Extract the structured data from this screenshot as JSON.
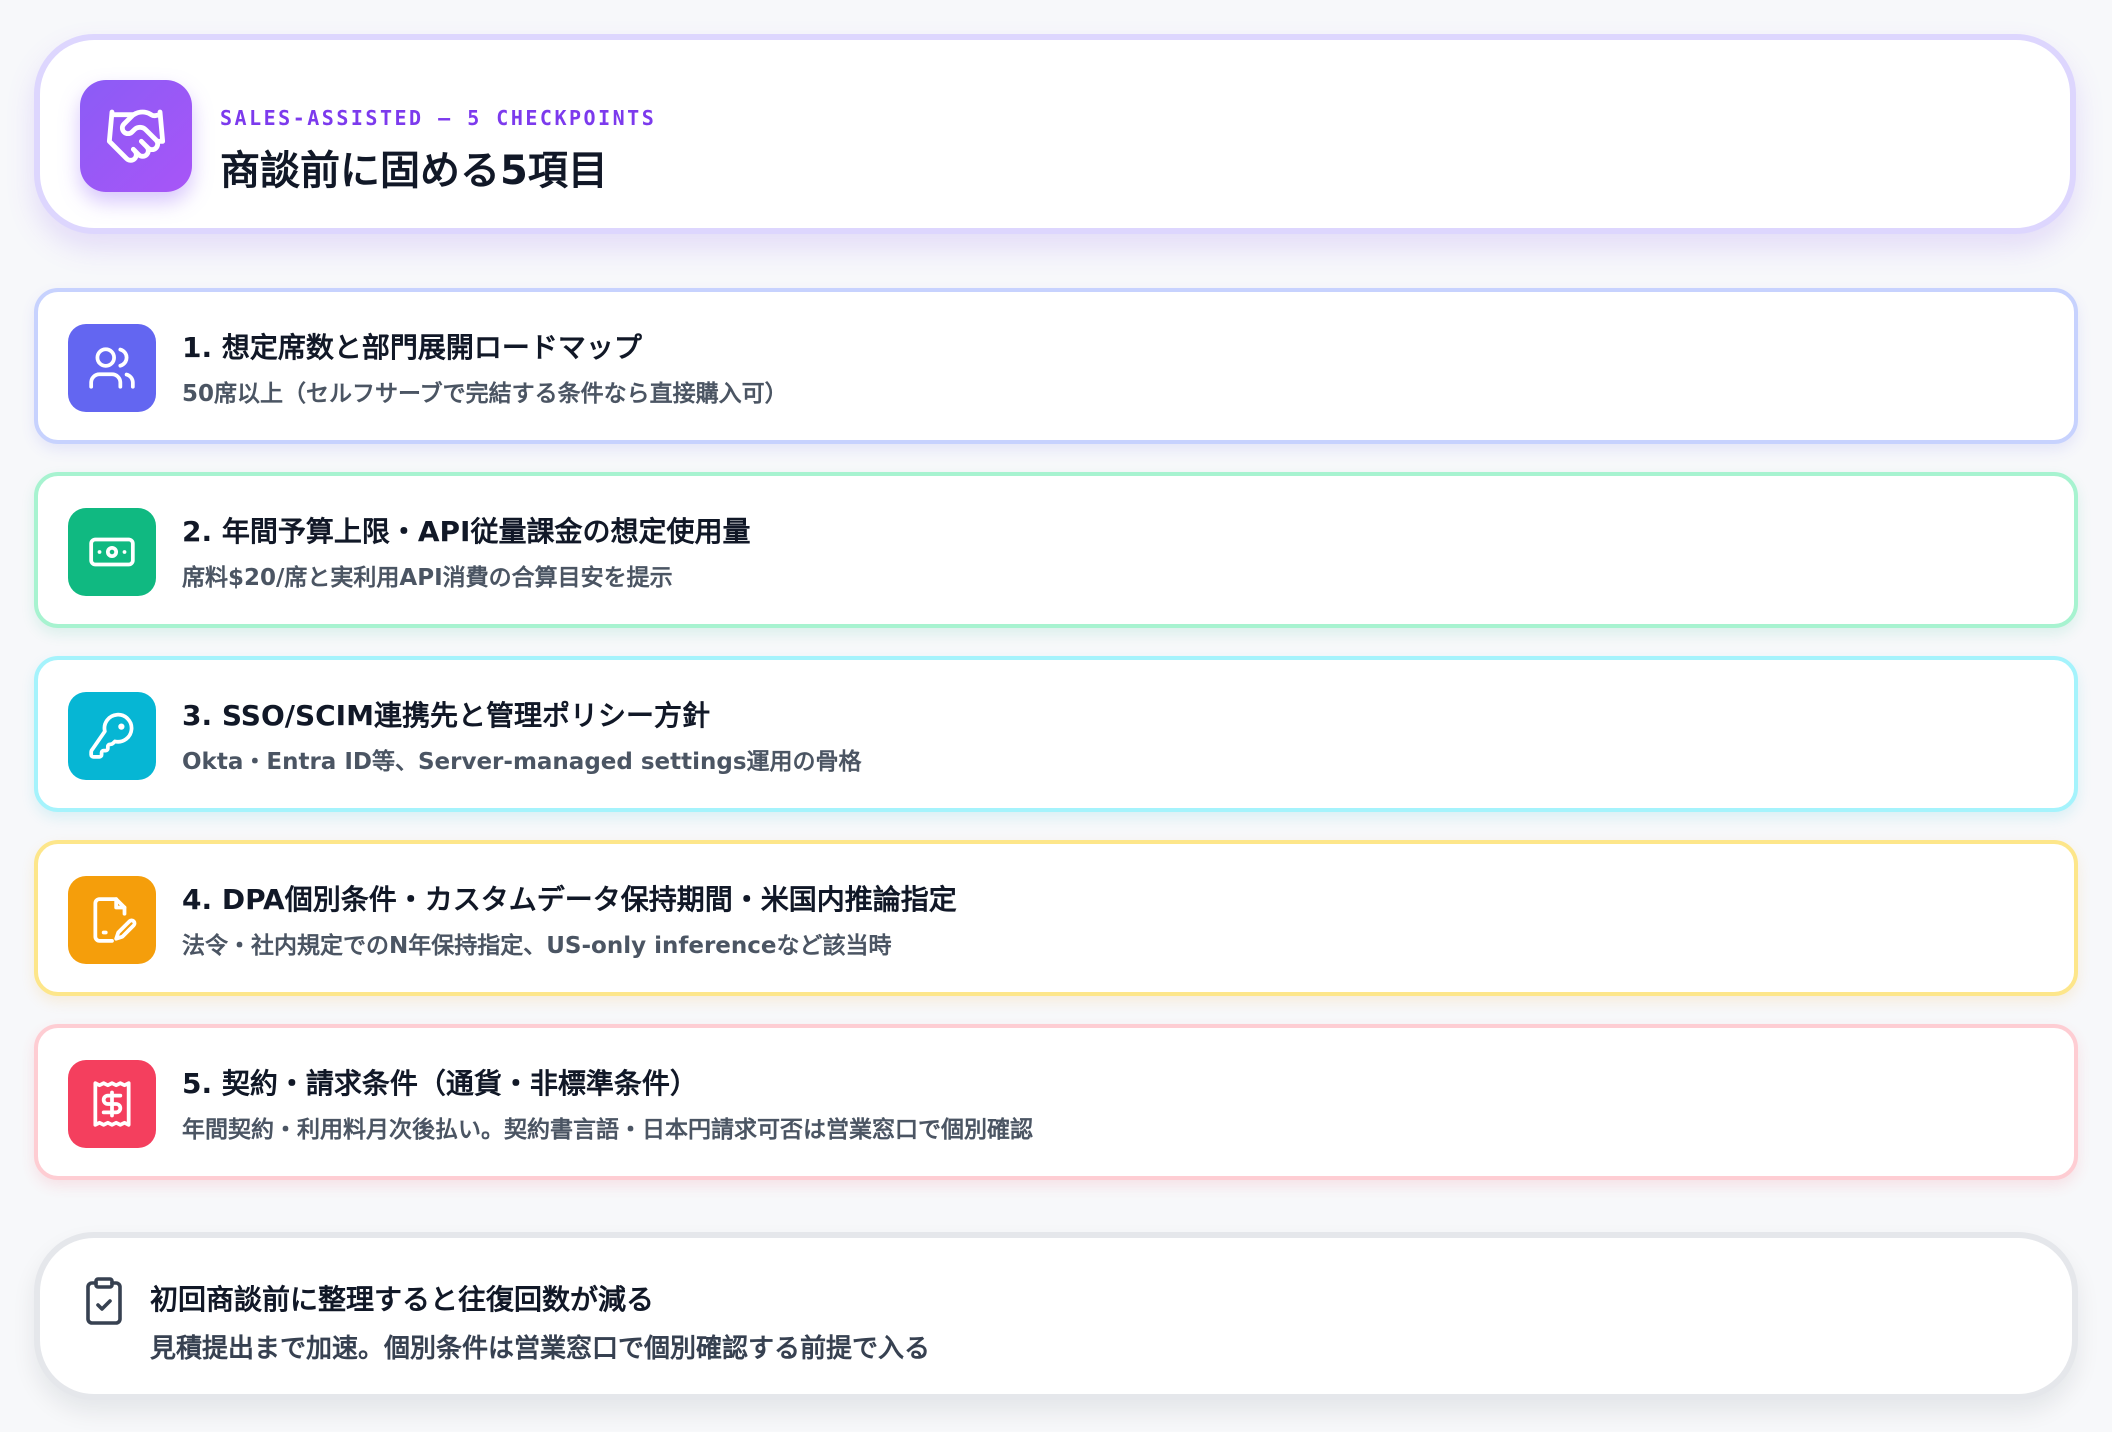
{
  "header": {
    "eyebrow": "SALES-ASSISTED — 5 CHECKPOINTS",
    "title": "商談前に固める5項目",
    "icon": "handshake-icon",
    "accent": "#8b5cf6"
  },
  "items": [
    {
      "number_title": "1. 想定席数と部門展開ロードマップ",
      "description": "50席以上（セルフサーブで完結する条件なら直接購入可）",
      "icon": "users-icon",
      "color": "#6366f1"
    },
    {
      "number_title": "2. 年間予算上限・API従量課金の想定使用量",
      "description": "席料$20/席と実利用API消費の合算目安を提示",
      "icon": "banknote-icon",
      "color": "#10b981"
    },
    {
      "number_title": "3. SSO/SCIM連携先と管理ポリシー方針",
      "description": "Okta・Entra ID等、Server-managed settings運用の骨格",
      "icon": "key-icon",
      "color": "#06b6d4"
    },
    {
      "number_title": "4. DPA個別条件・カスタムデータ保持期間・米国内推論指定",
      "description": "法令・社内規定でのN年保持指定、US-only inferenceなど該当時",
      "icon": "file-signature-icon",
      "color": "#f59e0b"
    },
    {
      "number_title": "5. 契約・請求条件（通貨・非標準条件）",
      "description": "年間契約・利用料月次後払い。契約書言語・日本円請求可否は営業窓口で個別確認",
      "icon": "receipt-dollar-icon",
      "color": "#f43f5e"
    }
  ],
  "footer": {
    "title": "初回商談前に整理すると往復回数が減る",
    "description": "見積提出まで加速。個別条件は営業窓口で個別確認する前提で入る",
    "icon": "clipboard-check-icon"
  }
}
